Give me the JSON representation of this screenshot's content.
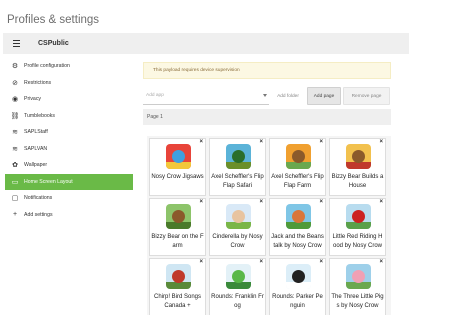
{
  "page": {
    "title": "Profiles & settings"
  },
  "header": {
    "org_name": "CSPublic"
  },
  "sidebar": {
    "items": [
      {
        "label": "Profile configuration",
        "icon": "gear-icon",
        "glyph": "⚙"
      },
      {
        "label": "Restrictions",
        "icon": "ban-icon",
        "glyph": "⊘"
      },
      {
        "label": "Privacy",
        "icon": "eye-icon",
        "glyph": "◉"
      },
      {
        "label": "Tumblebooks",
        "icon": "link-icon",
        "glyph": "⛓"
      },
      {
        "label": "SAPLStaff",
        "icon": "wifi-icon",
        "glyph": "≋"
      },
      {
        "label": "SAPLVAN",
        "icon": "wifi-icon",
        "glyph": "≋"
      },
      {
        "label": "Wallpaper",
        "icon": "flower-icon",
        "glyph": "✿"
      },
      {
        "label": "Home Screen Layout",
        "icon": "home-screen-icon",
        "glyph": "▭",
        "active": true
      },
      {
        "label": "Notifications",
        "icon": "notifications-icon",
        "glyph": "▢"
      },
      {
        "label": "Add settings",
        "icon": "plus-icon",
        "glyph": "+"
      }
    ]
  },
  "main": {
    "notice": "This payload requires device supervision",
    "add_app_placeholder": "Add app",
    "add_folder_label": "Add folder",
    "add_page_label": "Add page",
    "remove_page_label": "Remove page",
    "page_label": "Page 1"
  },
  "apps": [
    {
      "label": "Nosy Crow Jigsaws",
      "bg": "#e8443a",
      "fg": "#3fa0e0",
      "ground": "#f3c73a"
    },
    {
      "label": "Axel Scheffler's Flip Flap Safari",
      "bg": "#5bb3d8",
      "fg": "#2a6e2a",
      "ground": "#6b8f2a"
    },
    {
      "label": "Axel Scheffler's Flip Flap Farm",
      "bg": "#f0a030",
      "fg": "#8b5a2b",
      "ground": "#6aa84f"
    },
    {
      "label": "Bizzy Bear Builds a House",
      "bg": "#f2c14e",
      "fg": "#8b5a2b",
      "ground": "#c0392b"
    },
    {
      "label": "Bizzy Bear on the Farm",
      "bg": "#8dc46a",
      "fg": "#8b5a2b",
      "ground": "#4a7a2a"
    },
    {
      "label": "Cinderella by Nosy Crow",
      "bg": "#d9e9f7",
      "fg": "#e8c4a0",
      "ground": "#7ab648"
    },
    {
      "label": "Jack and the Beanstalk by Nosy Crow",
      "bg": "#7fc6e6",
      "fg": "#d9763a",
      "ground": "#4f9a3a"
    },
    {
      "label": "Little Red Riding Hood by Nosy Crow",
      "bg": "#b8dcef",
      "fg": "#cc2222",
      "ground": "#5aa04a"
    },
    {
      "label": "Chirp! Bird Songs Canada +",
      "bg": "#cfe6f3",
      "fg": "#c0392b",
      "ground": "#5a8a3a"
    },
    {
      "label": "Rounds: Franklin Frog",
      "bg": "#e3f1f7",
      "fg": "#59b848",
      "ground": "#3a8a3a"
    },
    {
      "label": "Rounds: Parker Penguin",
      "bg": "#dceef8",
      "fg": "#222222",
      "ground": "#ffffff"
    },
    {
      "label": "The Three Little Pigs by Nosy Crow",
      "bg": "#9ed0ea",
      "fg": "#f0a0b4",
      "ground": "#6aa84f"
    }
  ]
}
